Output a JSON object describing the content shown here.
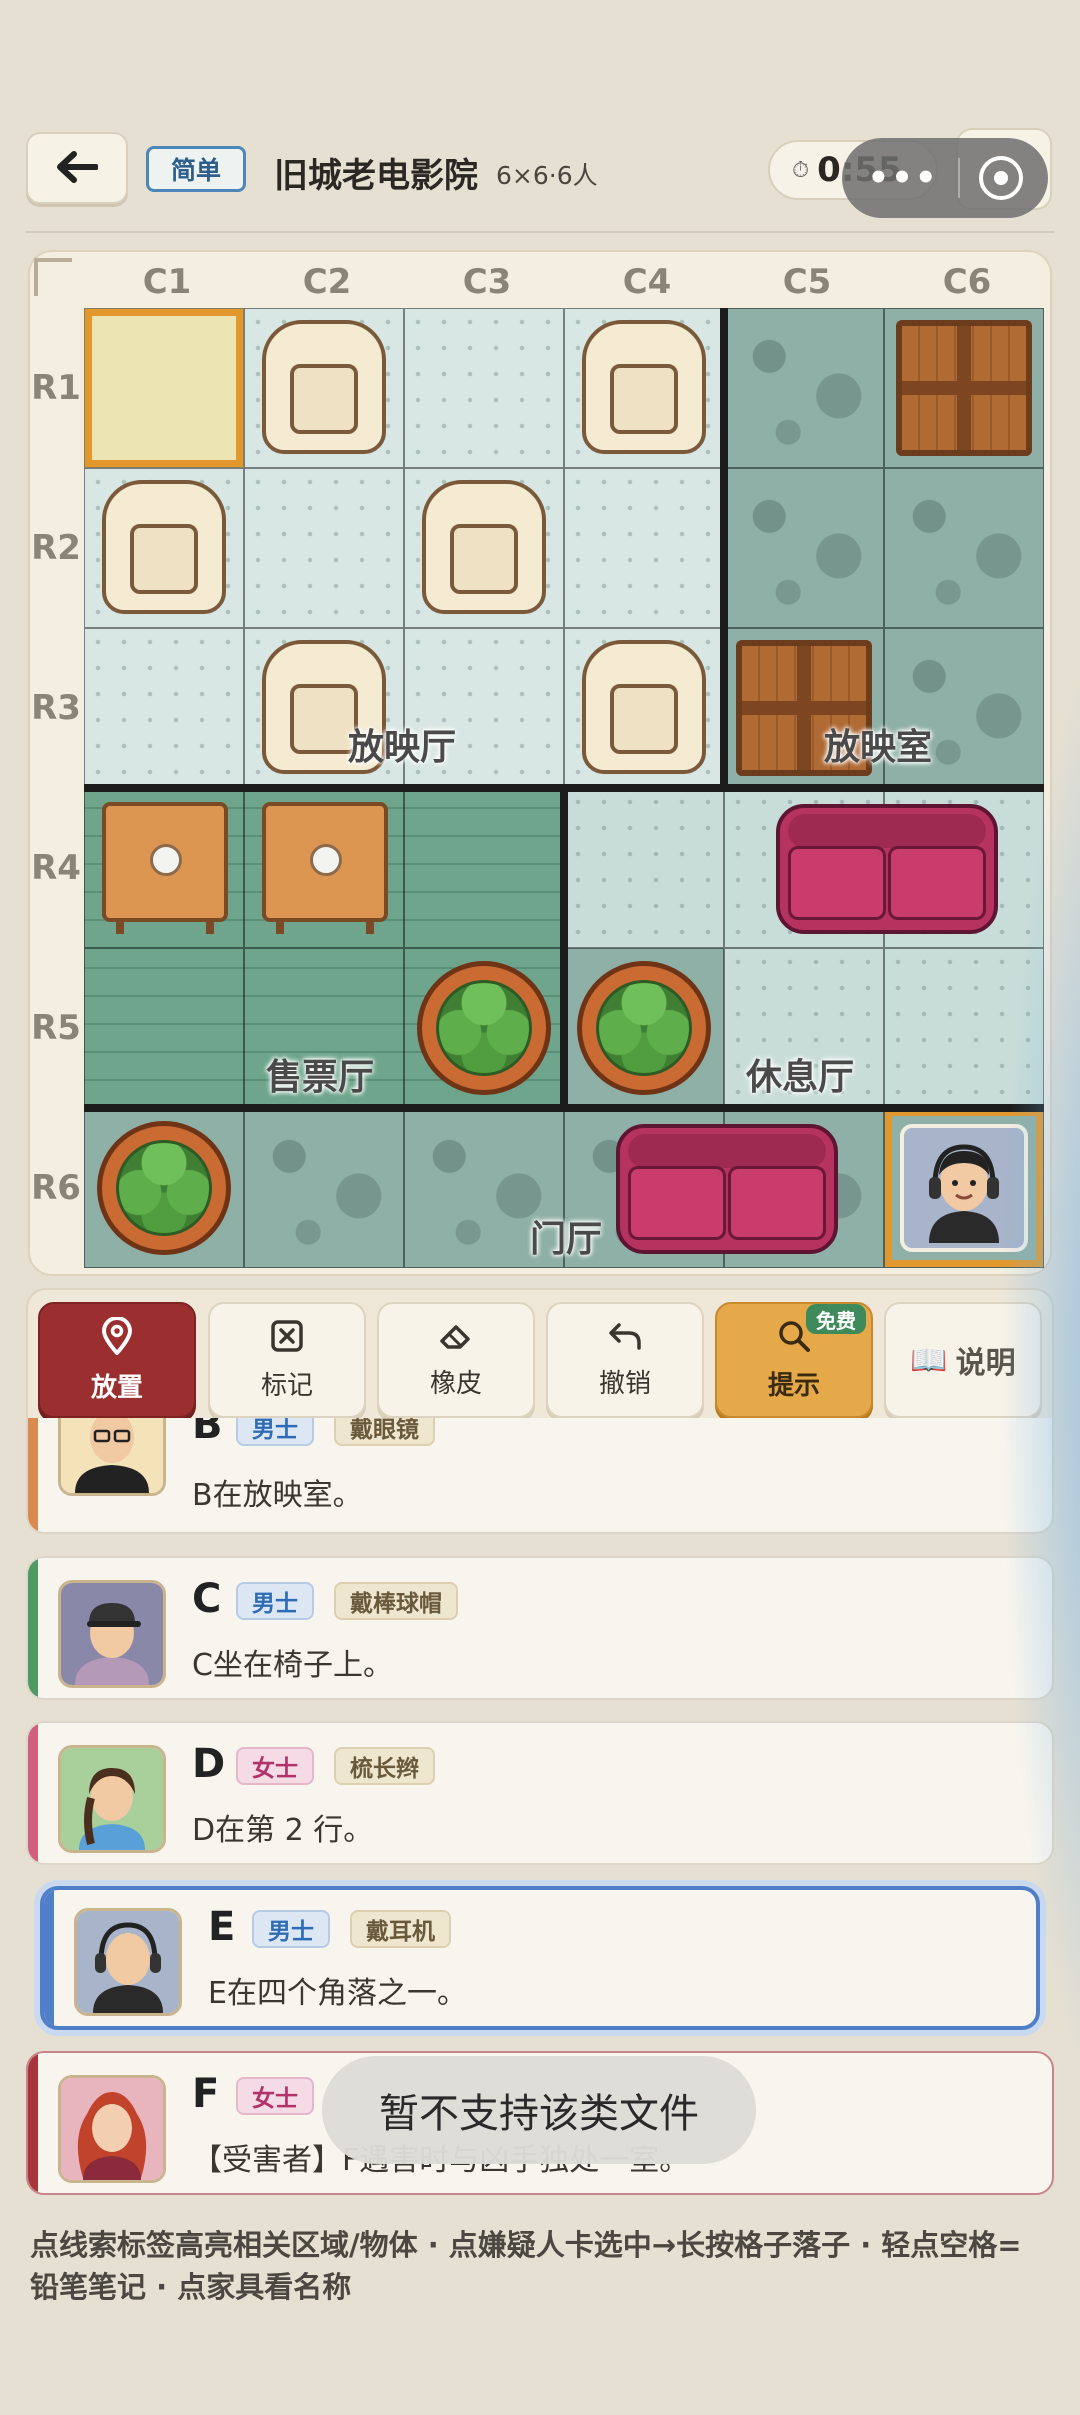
{
  "header": {
    "back_icon": "arrow-left-icon",
    "difficulty": "简单",
    "title": "旧城老电影院",
    "subtitle": "6×6·6人",
    "timer": "0:55"
  },
  "board": {
    "columns": [
      "C1",
      "C2",
      "C3",
      "C4",
      "C5",
      "C6"
    ],
    "rows": [
      "R1",
      "R2",
      "R3",
      "R4",
      "R5",
      "R6"
    ],
    "rooms": [
      "放映厅",
      "放映室",
      "售票厅",
      "休息厅",
      "门厅"
    ]
  },
  "toolbar": {
    "place": "放置",
    "mark": "标记",
    "eraser": "橡皮",
    "undo": "撤销",
    "hint": "提示",
    "free": "免费",
    "help": "说明"
  },
  "clues": [
    {
      "letter": "B",
      "gender": "男士",
      "trait": "戴眼镜",
      "text": "B在放映室。"
    },
    {
      "letter": "C",
      "gender": "男士",
      "trait": "戴棒球帽",
      "text": "C坐在椅子上。"
    },
    {
      "letter": "D",
      "gender": "女士",
      "trait": "梳长辫",
      "text": "D在第 2 行。"
    },
    {
      "letter": "E",
      "gender": "男士",
      "trait": "戴耳机",
      "text": "E在四个角落之一。"
    },
    {
      "letter": "F",
      "gender": "女士",
      "trait": "",
      "text": "【受害者】F遇害时与凶手独处一室。"
    }
  ],
  "toast": "暂不支持该类文件",
  "footer_hint": "点线索标签高亮相关区域/物体 · 点嫌疑人卡选中→长按格子落子 · 轻点空格=铅笔笔记 · 点家具看名称",
  "colors": {
    "accent_red": "#9b2f2f",
    "hint_gold": "#e6a94a",
    "highlight_orange": "#e2982c",
    "male_blue": "#2f6cb5",
    "female_pink": "#b2336a"
  }
}
